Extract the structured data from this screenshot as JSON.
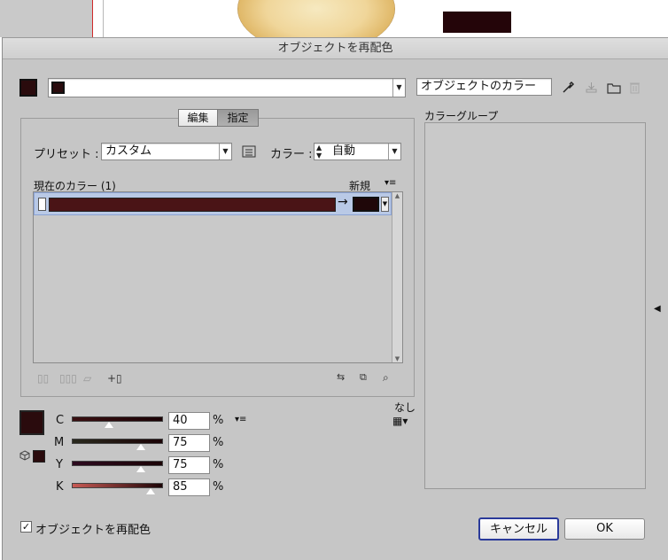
{
  "dialog": {
    "title": "オブジェクトを再配色"
  },
  "colors": {
    "current_swatch": "#2a0b0d",
    "color_bar": "#4a1416",
    "panel_bg": "#c6c6c6",
    "selection_bg": "#b9c9e6"
  },
  "top_row": {
    "artwork_colors_field": "オブジェクトのカラー",
    "icons": [
      "eyedropper-icon",
      "save-group-icon",
      "folder-icon",
      "trash-icon"
    ]
  },
  "tabs": {
    "edit": "編集",
    "assign": "指定"
  },
  "preset": {
    "label": "プリセット :",
    "value": "カスタム"
  },
  "colors_selector": {
    "label": "カラー :",
    "value": "自動"
  },
  "list": {
    "current_colors": "現在のカラー (1)",
    "new": "新規"
  },
  "sliders": [
    {
      "label": "C",
      "value": "40",
      "unit": "%",
      "fraction": 0.4
    },
    {
      "label": "M",
      "value": "75",
      "unit": "%",
      "fraction": 0.75
    },
    {
      "label": "Y",
      "value": "75",
      "unit": "%",
      "fraction": 0.75
    },
    {
      "label": "K",
      "value": "85",
      "unit": "%",
      "fraction": 0.85
    }
  ],
  "none_label": "なし",
  "color_groups_label": "カラーグループ",
  "recolor_checkbox": {
    "label": "オブジェクトを再配色",
    "checked": true
  },
  "buttons": {
    "cancel": "キャンセル",
    "ok": "OK"
  }
}
